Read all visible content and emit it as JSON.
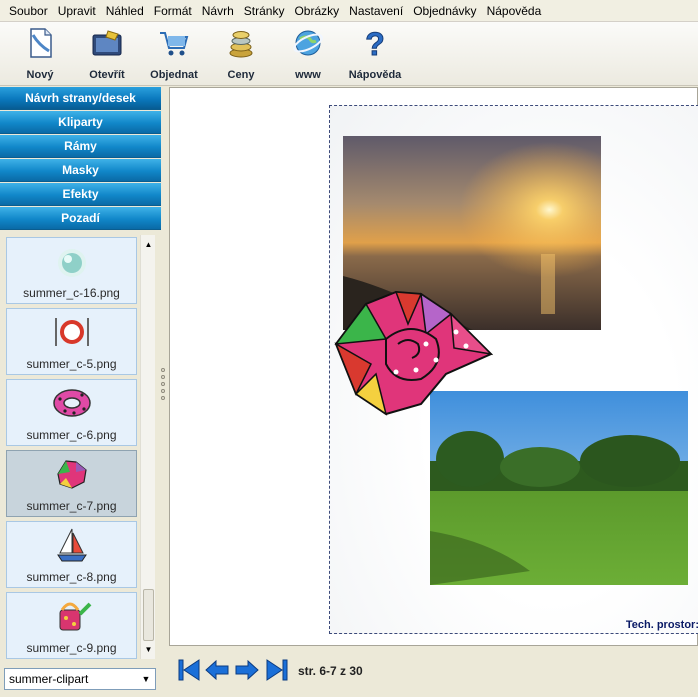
{
  "menu": [
    "Soubor",
    "Upravit",
    "Náhled",
    "Formát",
    "Návrh",
    "Stránky",
    "Obrázky",
    "Nastavení",
    "Objednávky",
    "Nápověda"
  ],
  "toolbar": {
    "new": "Nový",
    "open": "Otevřít",
    "order": "Objednat",
    "prices": "Ceny",
    "www": "www",
    "help": "Nápověda"
  },
  "sections": [
    "Návrh strany/desek",
    "Kliparty",
    "Rámy",
    "Masky",
    "Efekty",
    "Pozadí"
  ],
  "clipart": [
    {
      "file": "summer_c-16.png",
      "icon": "ball-icon"
    },
    {
      "file": "summer_c-5.png",
      "icon": "plate-cutlery-icon"
    },
    {
      "file": "summer_c-6.png",
      "icon": "swim-ring-icon"
    },
    {
      "file": "summer_c-7.png",
      "icon": "shell-icon",
      "selected": true
    },
    {
      "file": "summer_c-8.png",
      "icon": "sailboat-icon"
    },
    {
      "file": "summer_c-9.png",
      "icon": "watering-can-icon"
    }
  ],
  "category": "summer-clipart",
  "canvas": {
    "tech_label": "Tech. prostor:"
  },
  "pager": {
    "text": "str. 6-7 z 30"
  },
  "colors": {
    "accordion": "#1187c9",
    "pageBorder": "#3c4a7a"
  }
}
